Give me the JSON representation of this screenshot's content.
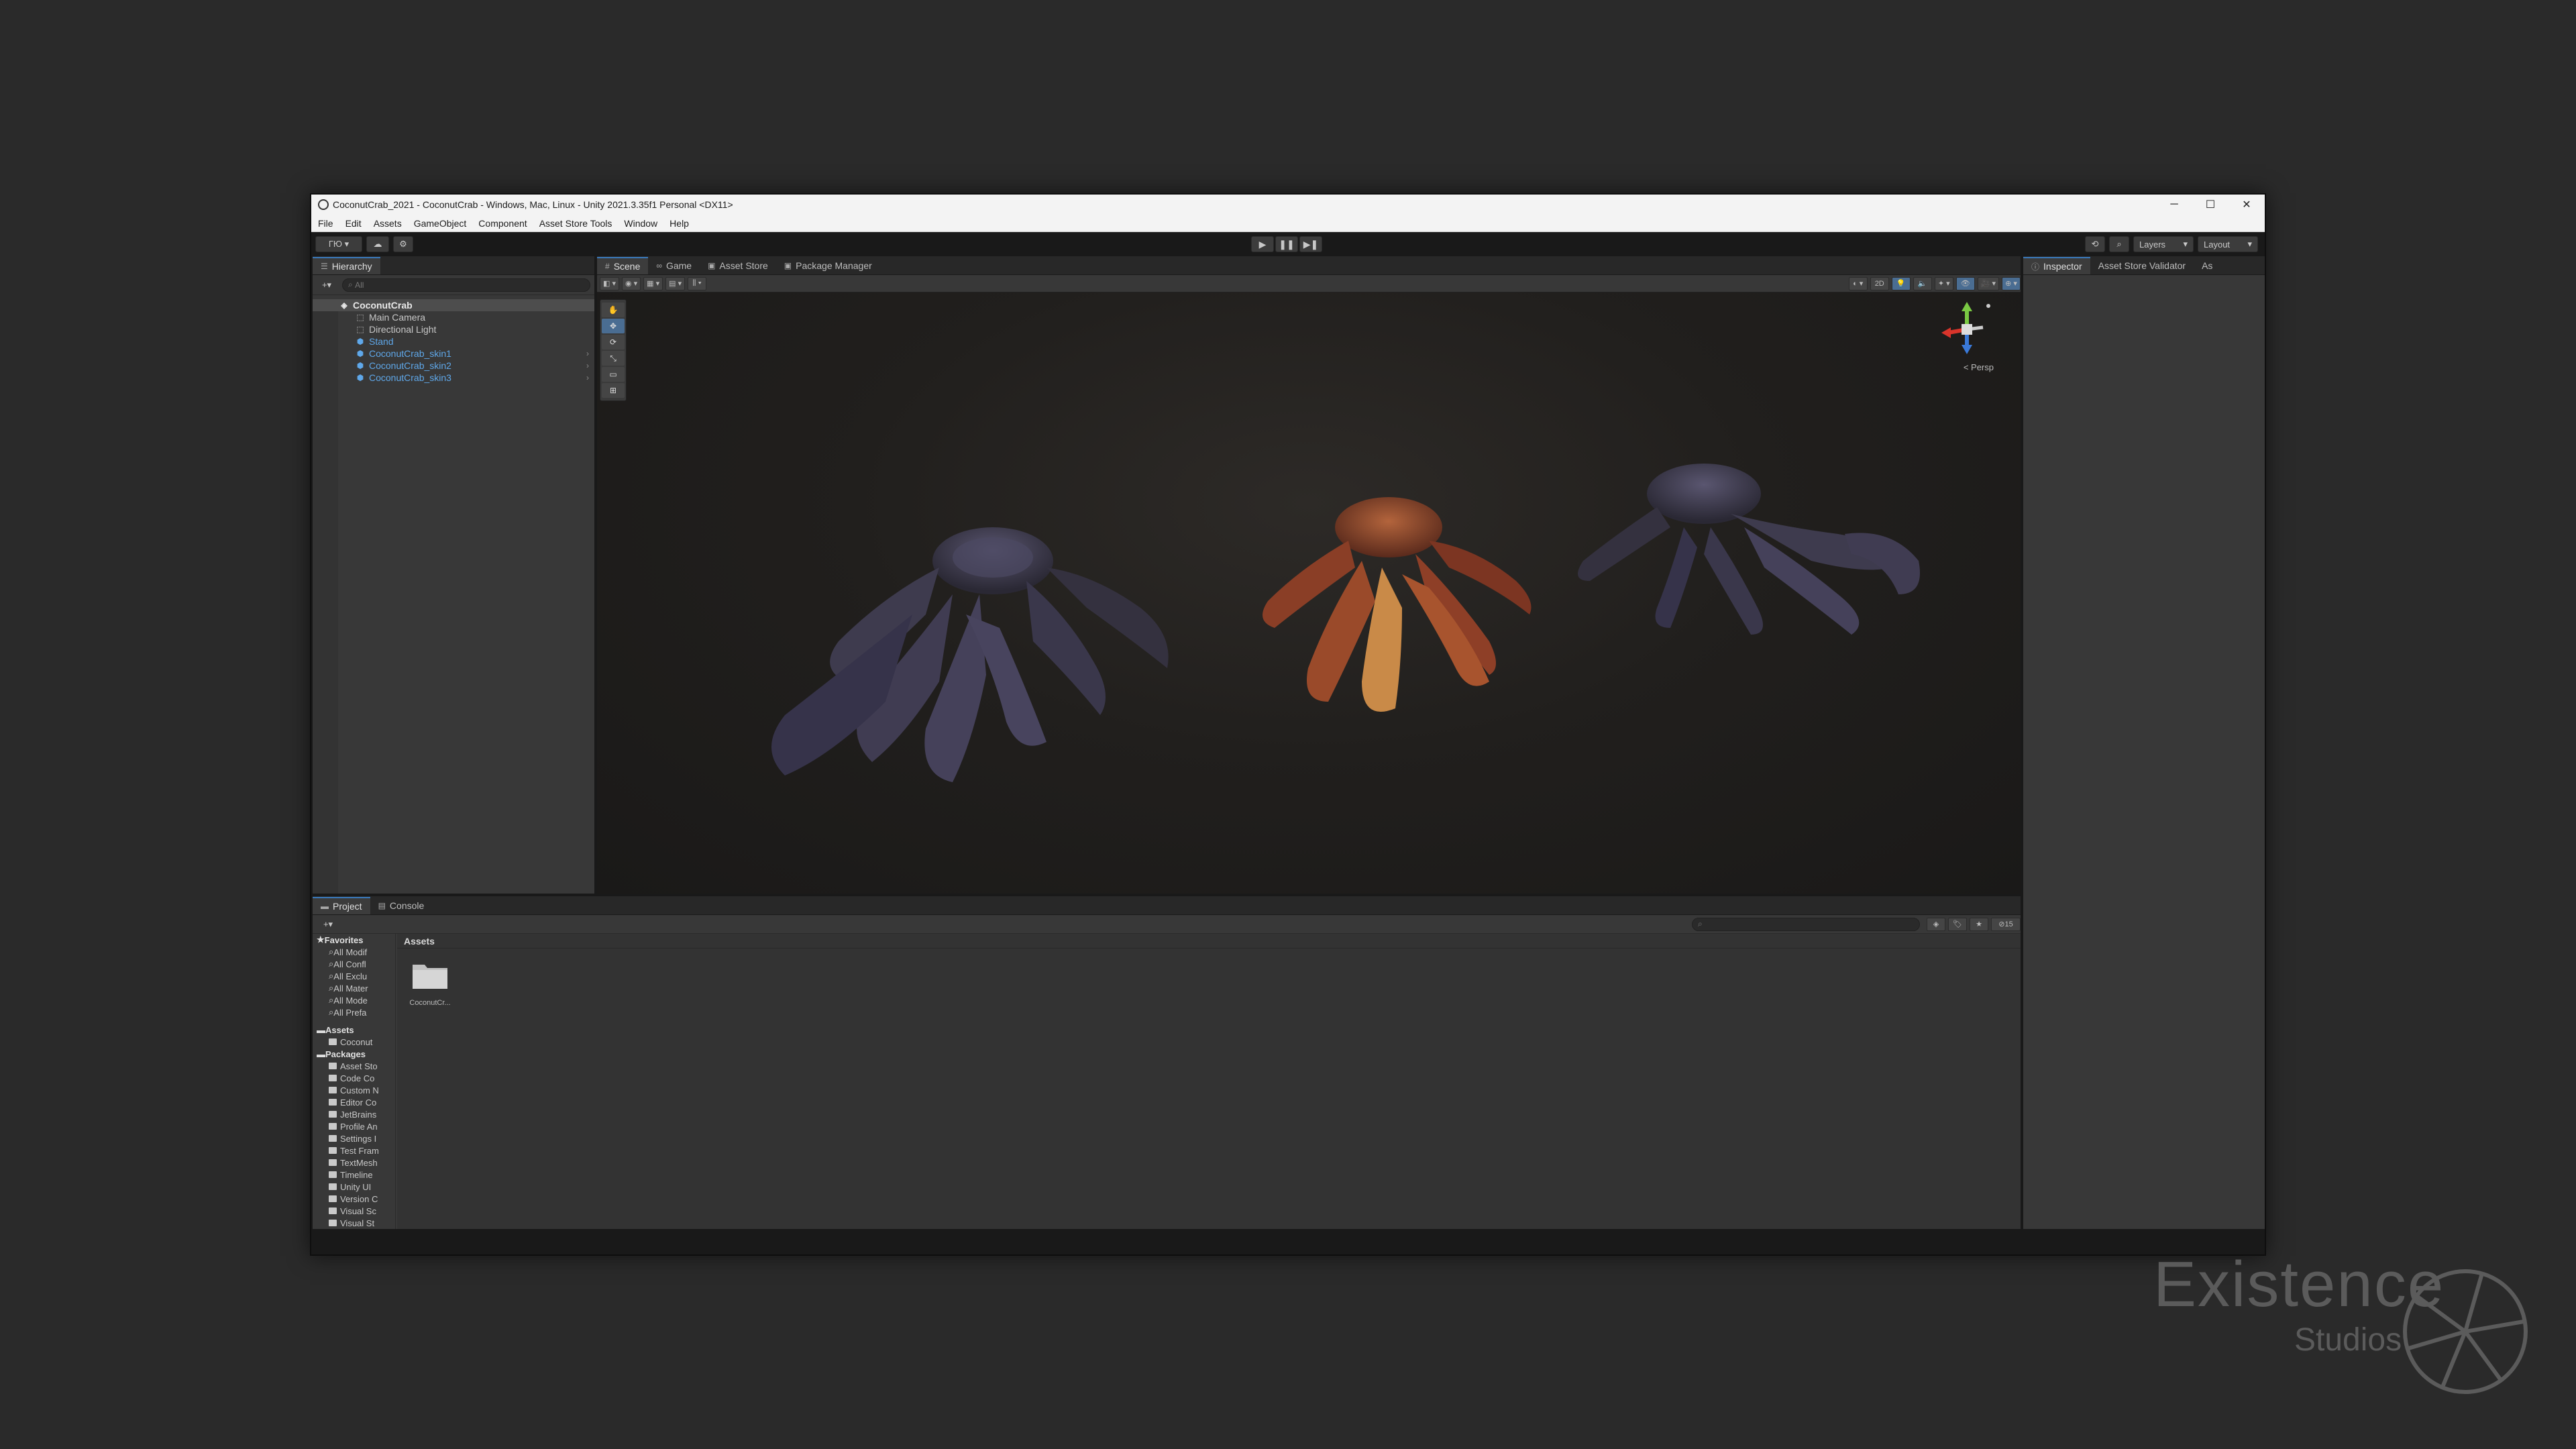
{
  "window": {
    "title": "CoconutCrab_2021 - CoconutCrab - Windows, Mac, Linux - Unity 2021.3.35f1 Personal <DX11>",
    "controls": [
      "─",
      "☐",
      "✕"
    ]
  },
  "menu": [
    "File",
    "Edit",
    "Assets",
    "GameObject",
    "Component",
    "Asset Store Tools",
    "Window",
    "Help"
  ],
  "toolbar": {
    "account_label": "ГЮ ▾",
    "play_icons": [
      "▶",
      "❚❚",
      "▶❚"
    ],
    "layers_label": "Layers",
    "layout_label": "Layout"
  },
  "hierarchy": {
    "tab_label": "Hierarchy",
    "search_placeholder": "All",
    "items": [
      {
        "label": "CoconutCrab",
        "icon": "unity-scene-icon",
        "kind": "root"
      },
      {
        "label": "Main Camera",
        "icon": "gameobject-icon",
        "kind": "object"
      },
      {
        "label": "Directional Light",
        "icon": "gameobject-icon",
        "kind": "object"
      },
      {
        "label": "Stand",
        "icon": "prefab-icon",
        "kind": "prefab"
      },
      {
        "label": "CoconutCrab_skin1",
        "icon": "prefab-icon",
        "kind": "prefab"
      },
      {
        "label": "CoconutCrab_skin2",
        "icon": "prefab-icon",
        "kind": "prefab"
      },
      {
        "label": "CoconutCrab_skin3",
        "icon": "prefab-icon",
        "kind": "prefab"
      }
    ]
  },
  "center_tabs": [
    {
      "label": "Scene",
      "icon": "#",
      "active": true
    },
    {
      "label": "Game",
      "icon": "∞",
      "active": false
    },
    {
      "label": "Asset Store",
      "icon": "▣",
      "active": false
    },
    {
      "label": "Package Manager",
      "icon": "▣",
      "active": false
    }
  ],
  "scene": {
    "persp_label": "< Persp",
    "tools": [
      "✋",
      "✥",
      "⟳",
      "⤡",
      "▭",
      "⊞"
    ]
  },
  "inspector": {
    "tabs": [
      "Inspector",
      "Asset Store Validator",
      "As"
    ]
  },
  "project": {
    "tabs": [
      "Project",
      "Console"
    ],
    "favorites_header": "Favorites",
    "favorites": [
      "All Modif",
      "All Confl",
      "All Exclu",
      "All Mater",
      "All Mode",
      "All Prefa"
    ],
    "assets_header": "Assets",
    "assets": [
      "Coconut"
    ],
    "packages_header": "Packages",
    "packages": [
      "Asset Sto",
      "Code Co",
      "Custom N",
      "Editor Co",
      "JetBrains",
      "Profile An",
      "Settings I",
      "Test Fram",
      "TextMesh",
      "Timeline",
      "Unity UI",
      "Version C",
      "Visual Sc",
      "Visual St",
      "Visual St"
    ],
    "breadcrumb": "Assets",
    "folder_name": "CoconutCr...",
    "hidden_count": "15"
  },
  "watermark": {
    "line1": "Existence",
    "line2": "Studios"
  },
  "colors": {
    "accent": "#3a79bb",
    "prefab_text": "#5fa8ea",
    "crab_blue": "#3a3748",
    "crab_orange": "#8a4a30"
  }
}
